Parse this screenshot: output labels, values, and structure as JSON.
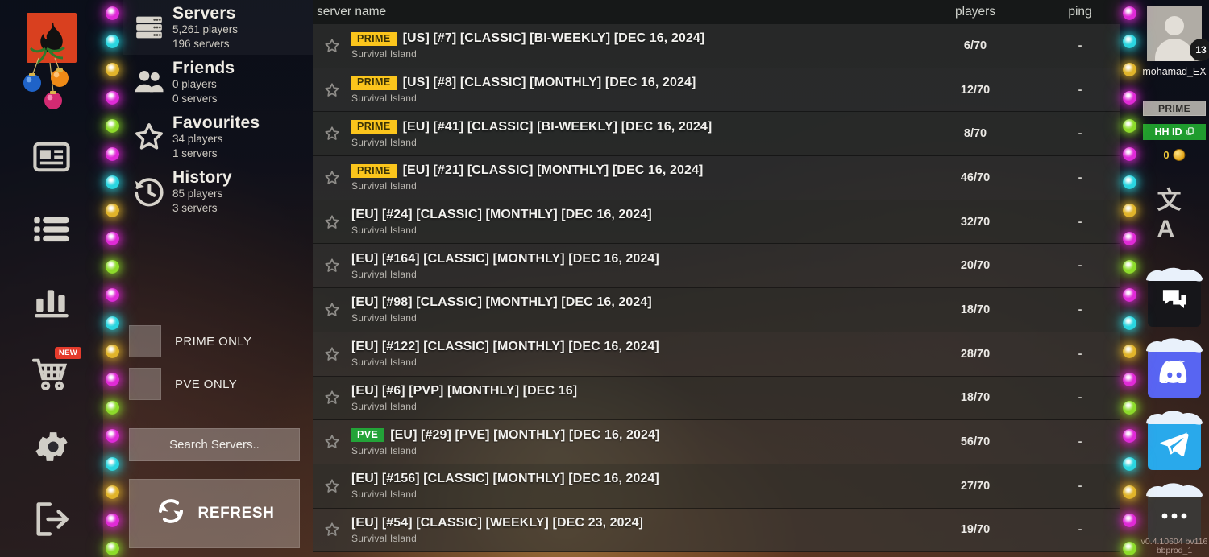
{
  "colors": {
    "prime_badge": "#fbc51c",
    "pve_badge": "#23a338",
    "hhid_green": "#1f9c2e",
    "discord": "#5865F2",
    "telegram": "#29A9EB",
    "logo_red": "#d9401f"
  },
  "left_rail": {
    "items": [
      {
        "name": "logo",
        "icon": "rust-flame-logo-icon"
      },
      {
        "name": "news",
        "icon": "news-icon"
      },
      {
        "name": "server-list",
        "icon": "list-icon"
      },
      {
        "name": "stats",
        "icon": "bar-chart-icon"
      },
      {
        "name": "store",
        "icon": "shopping-cart-icon",
        "badge": "NEW"
      },
      {
        "name": "settings",
        "icon": "gear-icon"
      },
      {
        "name": "exit",
        "icon": "exit-icon"
      }
    ],
    "store_badge": "NEW"
  },
  "categories": [
    {
      "title": "Servers",
      "players": "5,261 players",
      "servers": "196 servers",
      "icon": "servers-icon",
      "active": true
    },
    {
      "title": "Friends",
      "players": "0 players",
      "servers": "0 servers",
      "icon": "friends-icon",
      "active": false
    },
    {
      "title": "Favourites",
      "players": "34 players",
      "servers": "1 servers",
      "icon": "star-icon",
      "active": false
    },
    {
      "title": "History",
      "players": "85 players",
      "servers": "3 servers",
      "icon": "history-icon",
      "active": false
    }
  ],
  "filters": [
    {
      "label": "PRIME ONLY",
      "checked": false
    },
    {
      "label": "PVE ONLY",
      "checked": false
    }
  ],
  "search": {
    "label": "Search Servers.."
  },
  "refresh": {
    "label": "REFRESH",
    "icon": "refresh-icon"
  },
  "table": {
    "headers": {
      "name": "server name",
      "players": "players",
      "ping": "ping"
    },
    "rows": [
      {
        "badge": "PRIME",
        "badge_type": "prime",
        "name": "[US] [#7] [CLASSIC] [BI-WEEKLY] [DEC 16, 2024]",
        "map": "Survival Island",
        "players": "6/70",
        "ping": "-"
      },
      {
        "badge": "PRIME",
        "badge_type": "prime",
        "name": "[US] [#8] [CLASSIC] [MONTHLY] [DEC 16, 2024]",
        "map": "Survival Island",
        "players": "12/70",
        "ping": "-"
      },
      {
        "badge": "PRIME",
        "badge_type": "prime",
        "name": "[EU] [#41] [CLASSIC] [BI-WEEKLY] [DEC 16, 2024]",
        "map": "Survival Island",
        "players": "8/70",
        "ping": "-"
      },
      {
        "badge": "PRIME",
        "badge_type": "prime",
        "name": "[EU] [#21] [CLASSIC] [MONTHLY] [DEC 16, 2024]",
        "map": "Survival Island",
        "players": "46/70",
        "ping": "-"
      },
      {
        "badge": "",
        "badge_type": "none",
        "name": "[EU] [#24] [CLASSIC] [MONTHLY] [DEC 16, 2024]",
        "map": "Survival Island",
        "players": "32/70",
        "ping": "-"
      },
      {
        "badge": "",
        "badge_type": "none",
        "name": "[EU] [#164] [CLASSIC] [MONTHLY] [DEC 16, 2024]",
        "map": "Survival Island",
        "players": "20/70",
        "ping": "-"
      },
      {
        "badge": "",
        "badge_type": "none",
        "name": "[EU] [#98] [CLASSIC] [MONTHLY] [DEC 16, 2024]",
        "map": "Survival Island",
        "players": "18/70",
        "ping": "-"
      },
      {
        "badge": "",
        "badge_type": "none",
        "name": "[EU] [#122] [CLASSIC] [MONTHLY] [DEC 16, 2024]",
        "map": "Survival Island",
        "players": "28/70",
        "ping": "-"
      },
      {
        "badge": "",
        "badge_type": "none",
        "name": "[EU] [#6] [PVP] [MONTHLY] [DEC 16]",
        "map": "Survival Island",
        "players": "18/70",
        "ping": "-"
      },
      {
        "badge": "PVE",
        "badge_type": "pve",
        "name": "[EU] [#29] [PVE] [MONTHLY] [DEC 16, 2024]",
        "map": "Survival Island",
        "players": "56/70",
        "ping": "-"
      },
      {
        "badge": "",
        "badge_type": "none",
        "name": "[EU] [#156] [CLASSIC] [MONTHLY] [DEC 16, 2024]",
        "map": "Survival Island",
        "players": "27/70",
        "ping": "-"
      },
      {
        "badge": "",
        "badge_type": "none",
        "name": "[EU] [#54] [CLASSIC] [WEEKLY] [DEC 23, 2024]",
        "map": "Survival Island",
        "players": "19/70",
        "ping": "-"
      }
    ]
  },
  "profile": {
    "username": "mohamad_EX",
    "level": "13",
    "prime_label": "PRIME",
    "hhid_label": "HH ID",
    "coins": "0"
  },
  "right_rail": {
    "language_icon": "translate-icon",
    "apps": [
      {
        "name": "chat",
        "icon": "chat-icon"
      },
      {
        "name": "discord",
        "icon": "discord-icon"
      },
      {
        "name": "telegram",
        "icon": "telegram-icon"
      },
      {
        "name": "more",
        "icon": "more-dots-icon"
      }
    ]
  },
  "version": {
    "line1": "v0.4.10604 bv116",
    "line2": "bbprod_1"
  }
}
